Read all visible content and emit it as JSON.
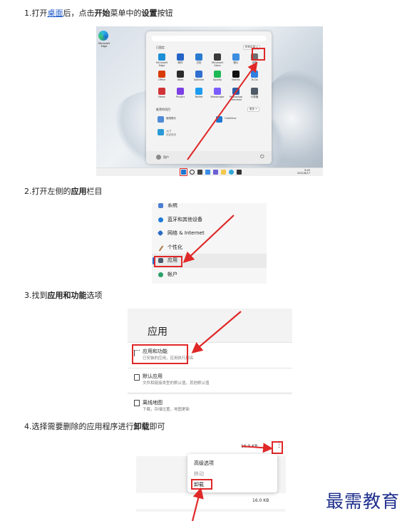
{
  "steps": {
    "s1": {
      "prefix": "1.打开",
      "link": "桌面",
      "mid": "后，点击",
      "bold1": "开始",
      "mid2": "菜单中的",
      "bold2": "设置",
      "suffix": "按钮"
    },
    "s2": {
      "prefix": "2.打开左侧的",
      "bold": "应用",
      "suffix": "栏目"
    },
    "s3": {
      "prefix": "3.找到",
      "bold": "应用和功能",
      "suffix": "选项"
    },
    "s4": {
      "prefix": "4.选择需要删除的应用程序进行",
      "bold": "卸载",
      "suffix": "即可"
    }
  },
  "screenshot1": {
    "desktop_icon_label": "Microsoft Edge",
    "pinned_label": "已固定",
    "all_apps_label": "所有应用 >",
    "recommended_label": "推荐的项目",
    "more_label": "更多 >",
    "apps": [
      "Microsoft Edge",
      "邮件",
      "日历",
      "Microsoft Store",
      "照片",
      "设置",
      "Office",
      "Xbox",
      "Solitaire",
      "Spotify",
      "Netflix",
      "To Do",
      "News",
      "PicsArt",
      "Twitter",
      "Messenger",
      "Photoshop Elements",
      "计算器"
    ],
    "recommended": [
      "使用提示",
      "OneDrive",
      "入门",
      "欢迎使用"
    ],
    "user_label": "用户",
    "clock_time": "9:45",
    "clock_date": "2021/6/17"
  },
  "screenshot2": {
    "nav": [
      "系统",
      "蓝牙和其他设备",
      "网络 & Internet",
      "个性化",
      "应用",
      "帐户"
    ]
  },
  "screenshot3": {
    "heading": "应用",
    "items": [
      {
        "title": "应用和功能",
        "sub": "已安装的应用，应用执行别名"
      },
      {
        "title": "默认应用",
        "sub": "文件和链接类型的默认值，其他默认值"
      },
      {
        "title": "离线地图",
        "sub": "下载，存储位置，地图更新"
      }
    ]
  },
  "screenshot4": {
    "top_size": "16.0 KB",
    "more_icon": "⋮",
    "menu": [
      "高级选项",
      "移动",
      "卸载"
    ],
    "row_size": "16.0 KB"
  },
  "watermark": "最需教育",
  "colors": {
    "highlight": "#e02828",
    "link": "#1a56c8",
    "watermark": "#1e2f8c"
  }
}
